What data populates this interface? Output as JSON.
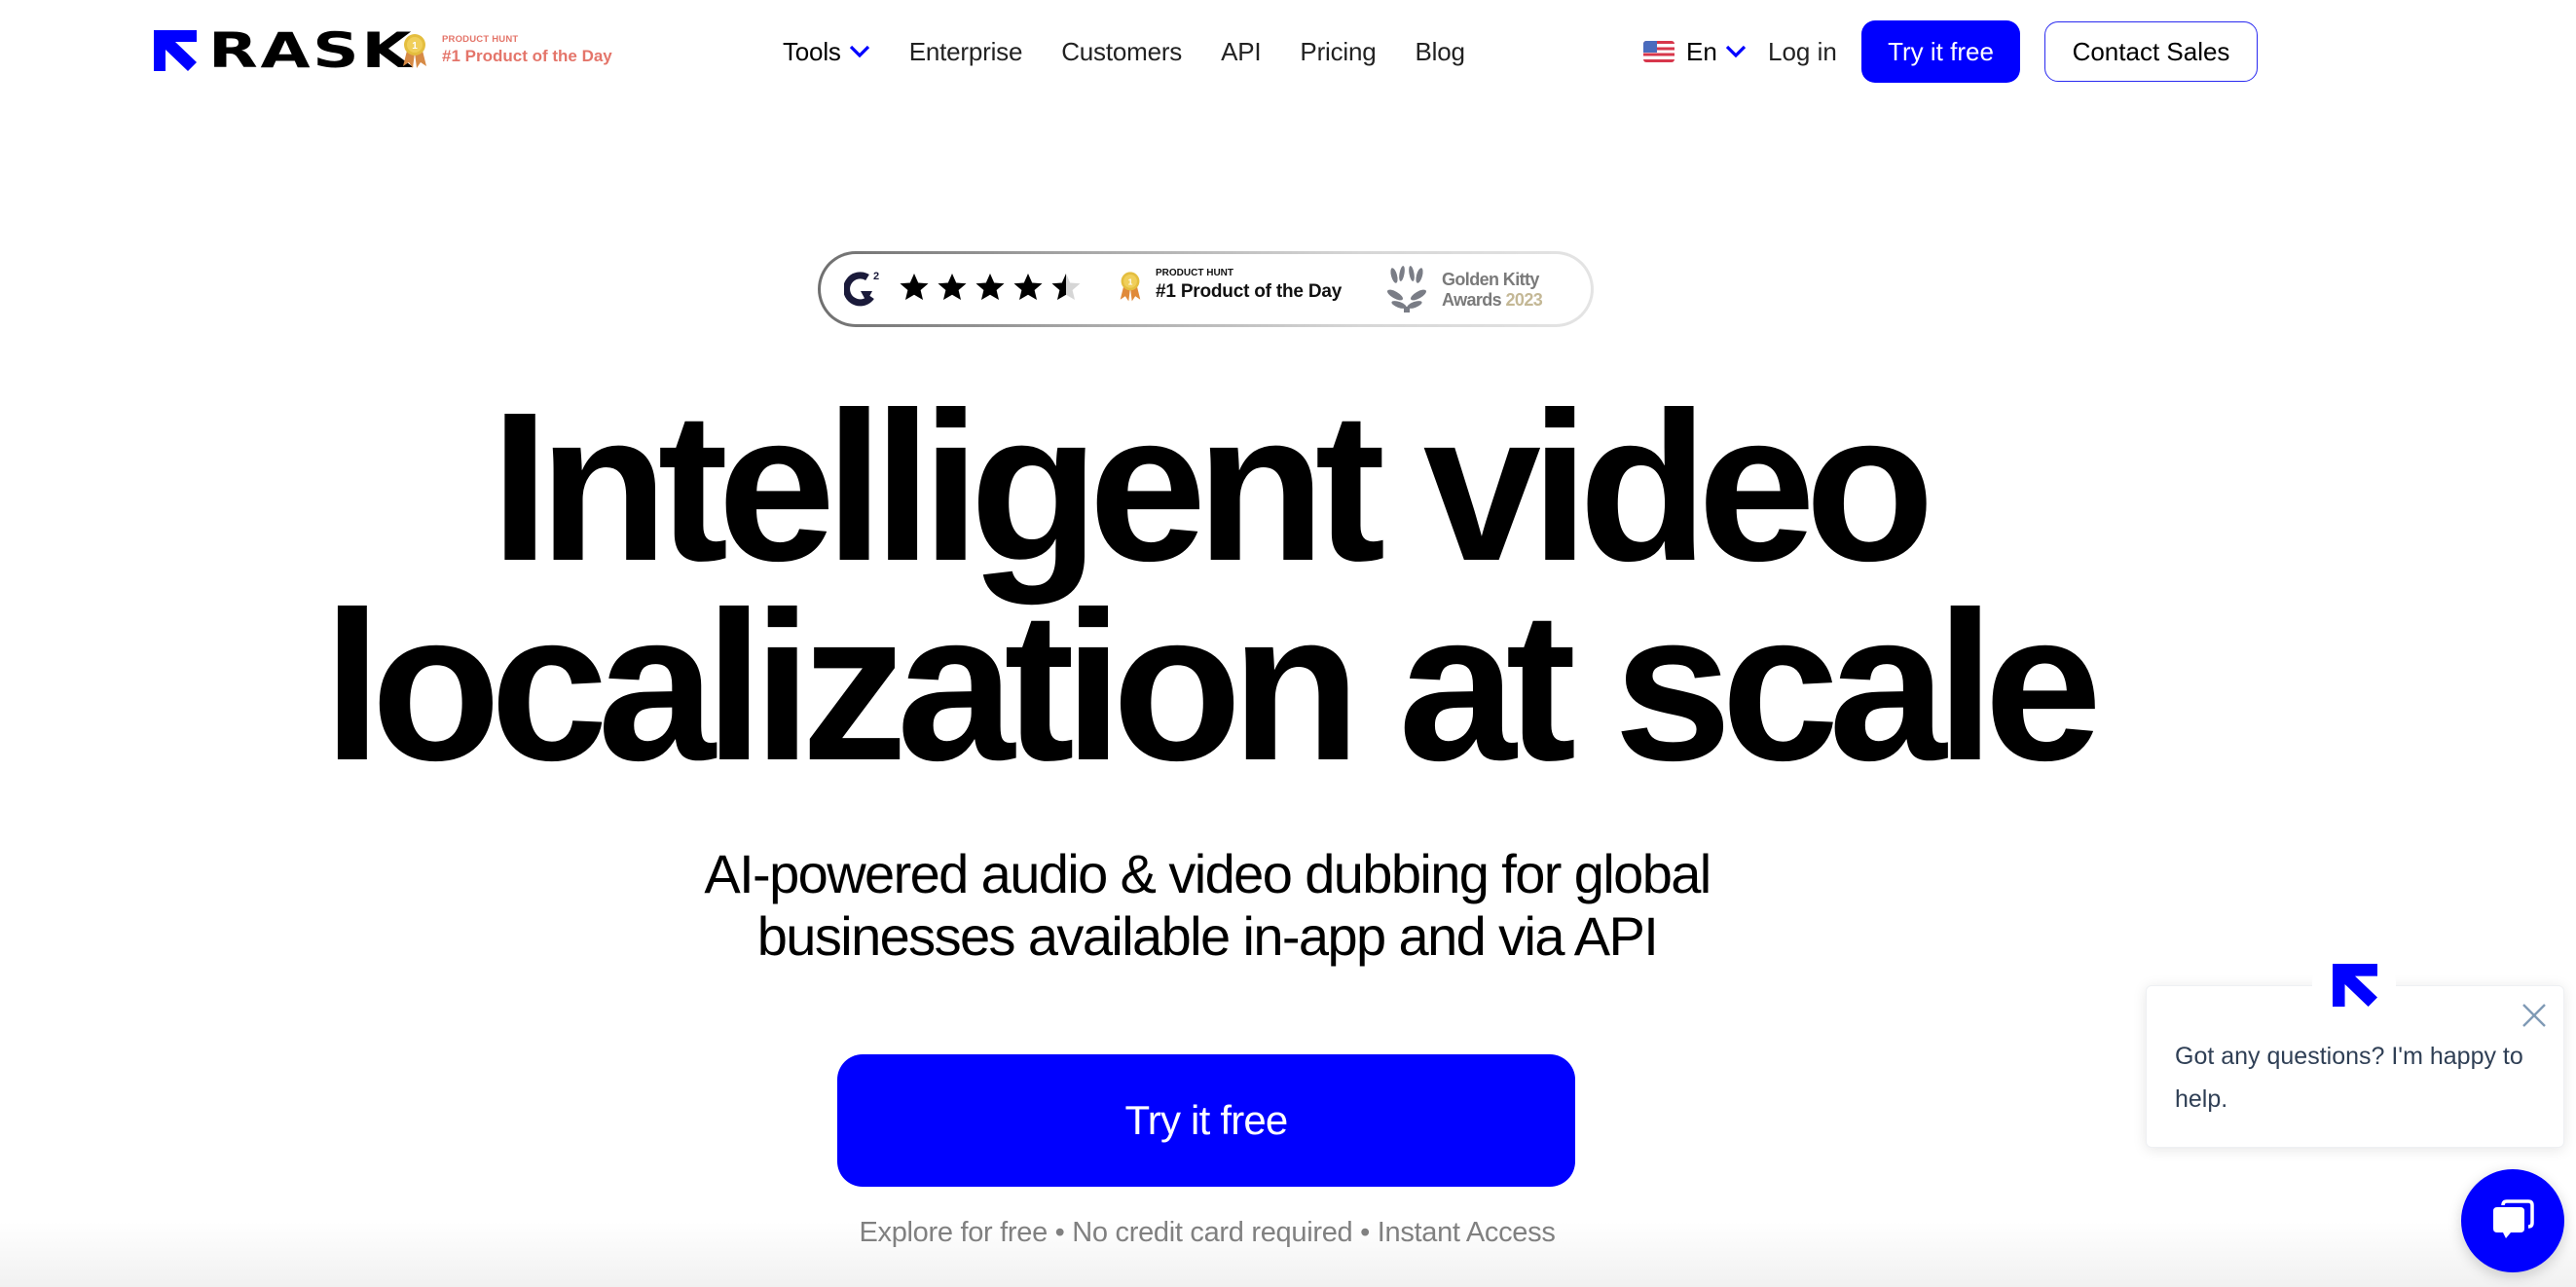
{
  "brand": {
    "name": "RASK",
    "accent_color": "#0000ff",
    "product_hunt_badge": {
      "kicker": "PRODUCT HUNT",
      "title": "#1 Product of the Day",
      "color": "#e4756a",
      "medal_rank": "1"
    }
  },
  "nav": {
    "items": [
      {
        "label": "Tools",
        "has_dropdown": true
      },
      {
        "label": "Enterprise"
      },
      {
        "label": "Customers"
      },
      {
        "label": "API"
      },
      {
        "label": "Pricing"
      },
      {
        "label": "Blog"
      }
    ],
    "language": {
      "flag": "us-flag-icon",
      "label": "En"
    },
    "login_label": "Log in",
    "try_free_label": "Try it free",
    "contact_sales_label": "Contact Sales"
  },
  "awards": {
    "g2": {
      "label": "G2",
      "rating": 4.5,
      "max_rating": 5
    },
    "product_hunt": {
      "kicker": "PRODUCT HUNT",
      "title": "#1 Product of the Day"
    },
    "golden_kitty": {
      "line1": "Golden Kitty",
      "line2_prefix": "Awards ",
      "year": "2023"
    }
  },
  "hero": {
    "headline_lines": [
      "Intelligent video",
      "localization at scale"
    ],
    "subhead_lines": [
      "AI-powered audio & video dubbing for global",
      "businesses available in-app and via API"
    ],
    "cta_label": "Try it free",
    "reassurance": "Explore for free • No credit card required • Instant Access"
  },
  "chat": {
    "message": "Got any questions? I'm happy to help.",
    "close_icon": "close-icon",
    "launcher_icon": "chat-bubbles-icon",
    "text_color": "#2f3f55",
    "close_color": "#7f9ab5"
  }
}
